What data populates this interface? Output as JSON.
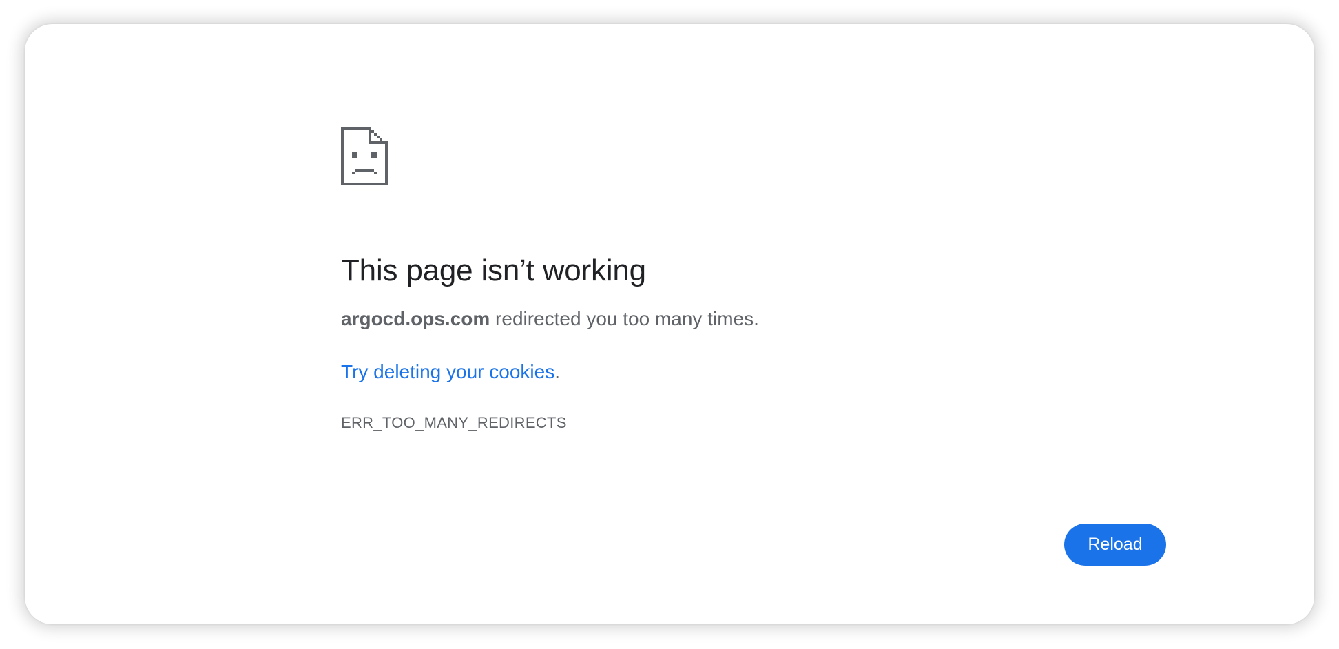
{
  "error": {
    "icon": "sad-document-icon",
    "title": "This page isn’t working",
    "host": "argocd.ops.com",
    "message_suffix": " redirected you too many times.",
    "suggestion_link": "Try deleting your cookies",
    "suggestion_suffix": ".",
    "code": "ERR_TOO_MANY_REDIRECTS"
  },
  "actions": {
    "reload_label": "Reload"
  },
  "colors": {
    "title": "#202124",
    "body_text": "#5f6368",
    "link": "#1a73e8",
    "button": "#1a73e8",
    "icon": "#5f6368"
  }
}
